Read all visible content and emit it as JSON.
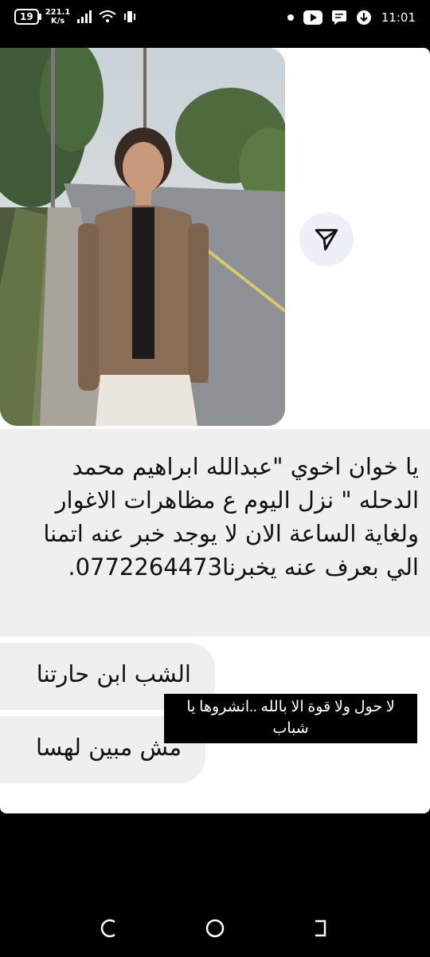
{
  "status_bar": {
    "battery": "19",
    "net_speed_value": "221.1",
    "net_speed_unit": "K/s",
    "time": "11:01",
    "icons": [
      "signal-icon",
      "wifi-icon",
      "vibrate-icon",
      "dot-icon",
      "youtube-icon",
      "message-icon",
      "download-icon"
    ]
  },
  "post": {
    "image_desc": "young man in brown jacket standing on roadside",
    "message_main": "يا خوان اخوي \"عبدالله ابراهيم محمد الدحله \" نزل اليوم ع مظاهرات الاغوار ولغاية الساعة الان لا يوجد خبر عنه اتمنا الي بعرف عنه يخبرنا0772264473.",
    "reply_1": "الشب ابن حارتنا",
    "reply_2": "مش مبين لهسا",
    "overlay_caption": "لا حول ولا قوة الا بالله ..انشروها يا شباب"
  },
  "colors": {
    "background": "#000000",
    "card": "#ffffff",
    "bubble": "#efefef",
    "share_button": "#eef0f7"
  },
  "nav_bar": {
    "icons": [
      "recents-icon",
      "home-icon",
      "back-icon"
    ]
  }
}
